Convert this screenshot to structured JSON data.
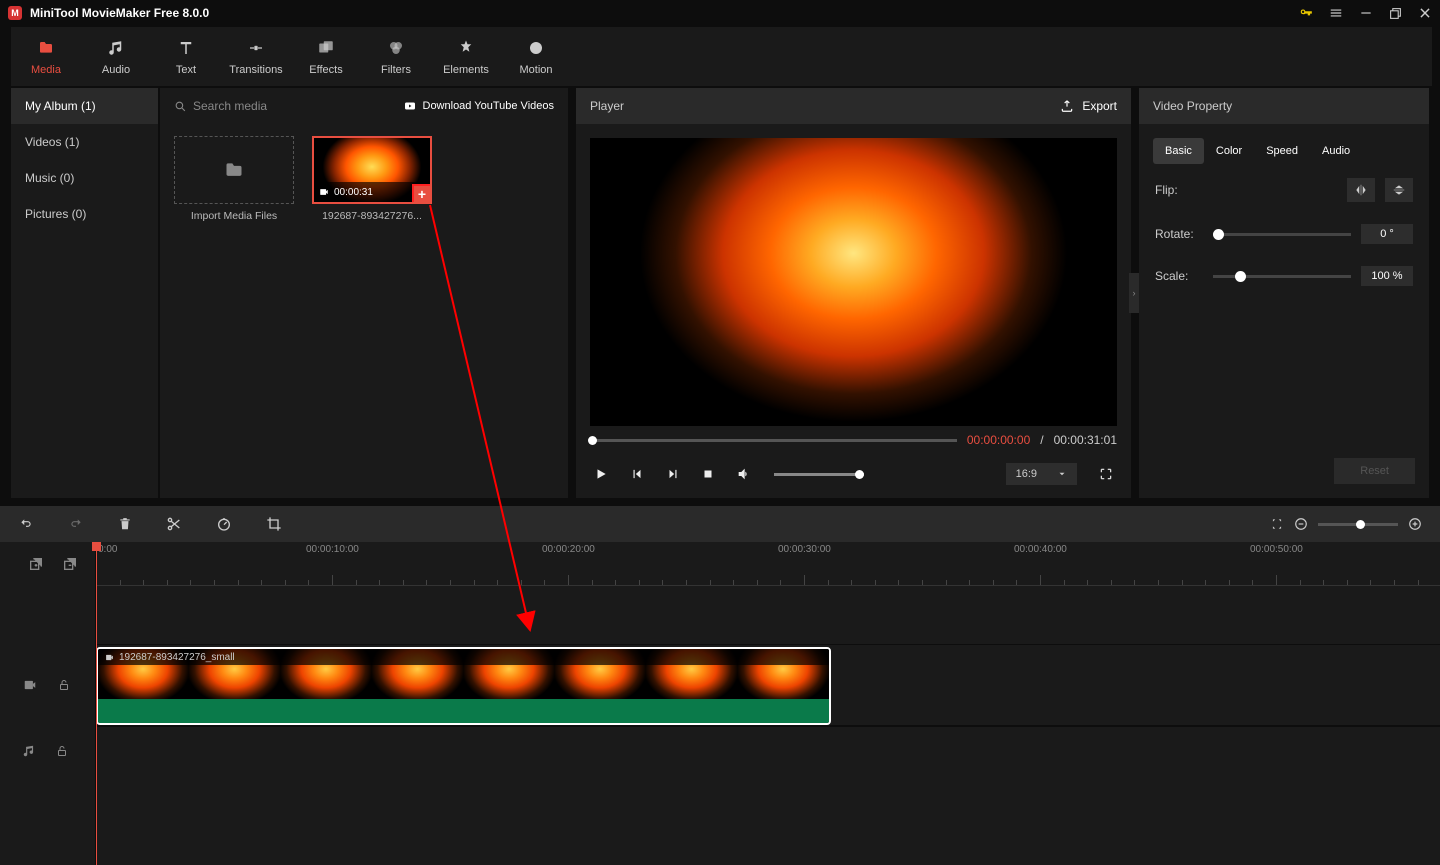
{
  "app": {
    "title": "MiniTool MovieMaker Free 8.0.0"
  },
  "toolbar": [
    {
      "label": "Media",
      "icon": "folder",
      "active": true
    },
    {
      "label": "Audio",
      "icon": "music",
      "active": false
    },
    {
      "label": "Text",
      "icon": "text",
      "active": false
    },
    {
      "label": "Transitions",
      "icon": "transition",
      "active": false
    },
    {
      "label": "Effects",
      "icon": "effects",
      "active": false
    },
    {
      "label": "Filters",
      "icon": "filters",
      "active": false
    },
    {
      "label": "Elements",
      "icon": "elements",
      "active": false
    },
    {
      "label": "Motion",
      "icon": "motion",
      "active": false
    }
  ],
  "sidebar": {
    "header": "My Album (1)",
    "items": [
      "Videos (1)",
      "Music (0)",
      "Pictures (0)"
    ]
  },
  "media": {
    "search_placeholder": "Search media",
    "download_label": "Download YouTube Videos",
    "import_label": "Import Media Files",
    "clip": {
      "duration": "00:00:31",
      "name": "192687-893427276..."
    }
  },
  "player": {
    "title": "Player",
    "export": "Export",
    "current": "00:00:00:00",
    "total": "00:00:31:01",
    "ratio": "16:9"
  },
  "property": {
    "title": "Video Property",
    "tabs": [
      "Basic",
      "Color",
      "Speed",
      "Audio"
    ],
    "flip_label": "Flip:",
    "rotate_label": "Rotate:",
    "rotate_value": "0 °",
    "scale_label": "Scale:",
    "scale_value": "100 %",
    "reset": "Reset"
  },
  "timeline": {
    "marks": [
      "0:00",
      "00:00:10:00",
      "00:00:20:00",
      "00:00:30:00",
      "00:00:40:00",
      "00:00:50:00"
    ],
    "clip_name": "192687-893427276_small"
  }
}
